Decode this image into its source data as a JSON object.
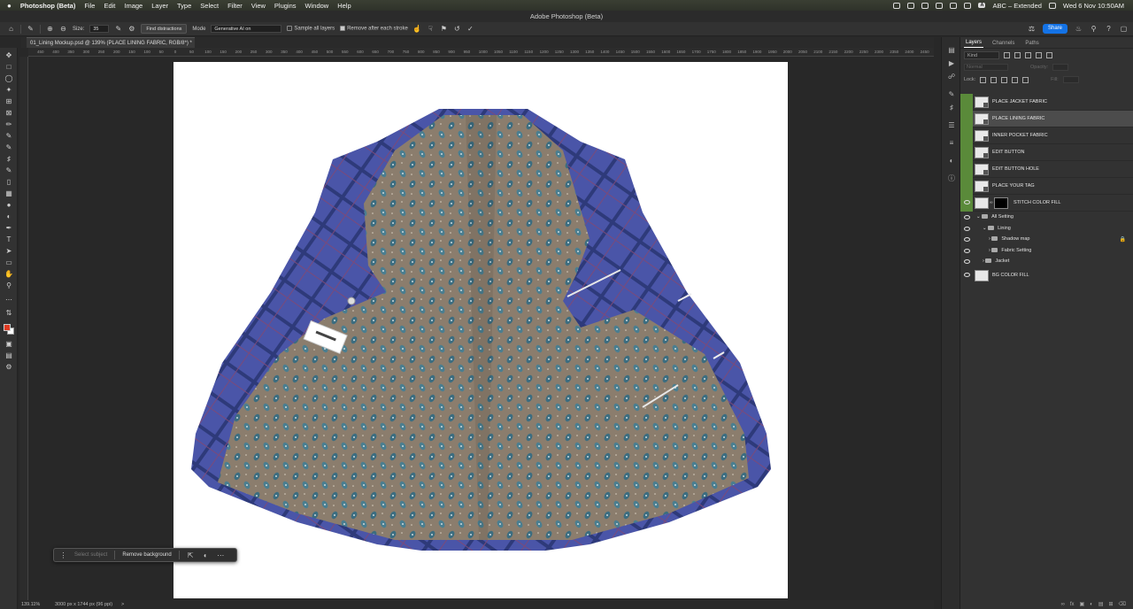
{
  "menubar": {
    "apple": "",
    "app_name": "Photoshop (Beta)",
    "items": [
      "File",
      "Edit",
      "Image",
      "Layer",
      "Type",
      "Select",
      "Filter",
      "View",
      "Plugins",
      "Window",
      "Help"
    ],
    "input_source": "ABC – Extended",
    "datetime": "Wed 6 Nov  10:50AM"
  },
  "window": {
    "title": "Adobe Photoshop (Beta)"
  },
  "options": {
    "size_label": "Size:",
    "size_value": "35",
    "find_distractions": "Find distractions",
    "mode_label": "Mode",
    "mode_value": "Generative AI on",
    "sample_all_layers": "Sample all layers",
    "remove_after_stroke": "Remove after each stroke",
    "share": "Share"
  },
  "document": {
    "tab": "01_Lining Mockup.psd @ 139% (PLACE LINING FABRIC, RGB/8*) *"
  },
  "ruler_ticks": [
    "450",
    "400",
    "350",
    "300",
    "250",
    "200",
    "150",
    "100",
    "50",
    "0",
    "50",
    "100",
    "150",
    "200",
    "250",
    "300",
    "350",
    "400",
    "450",
    "500",
    "550",
    "600",
    "650",
    "700",
    "750",
    "800",
    "850",
    "900",
    "950",
    "1000",
    "1050",
    "1100",
    "1150",
    "1200",
    "1250",
    "1300",
    "1350",
    "1400",
    "1450",
    "1500",
    "1550",
    "1600",
    "1650",
    "1700",
    "1750",
    "1800",
    "1850",
    "1900",
    "1950",
    "2000",
    "2050",
    "2100",
    "2150",
    "2200",
    "2250",
    "2300",
    "2350",
    "2400",
    "2450"
  ],
  "context_bar": {
    "select_subject": "Select subject",
    "remove_background": "Remove background"
  },
  "status": {
    "zoom": "139.11%",
    "dimensions": "3000 px x 1744 px (96 ppi)",
    "arrow": ">"
  },
  "panel": {
    "tabs": [
      "Layers",
      "Channels",
      "Paths"
    ],
    "kind": "Kind",
    "blend_mode": "Normal",
    "opacity_label": "Opacity:",
    "opacity_value": "",
    "lock_label": "Lock:",
    "fill_label": "Fill:",
    "fill_value": ""
  },
  "layers": [
    {
      "name": "PLACE JACKET FABRIC"
    },
    {
      "name": "PLACE LINING FABRIC"
    },
    {
      "name": "INNER POCKET FABRIC"
    },
    {
      "name": "EDIT BUTTON"
    },
    {
      "name": "EDIT BUTTON HOLE"
    },
    {
      "name": "PLACE YOUR TAG"
    },
    {
      "name": "STITCH COLOR FILL"
    }
  ],
  "groups": [
    {
      "name": "All Setting"
    },
    {
      "name": "Lining"
    },
    {
      "name": "Shadow map"
    },
    {
      "name": "Fabric Setting"
    },
    {
      "name": "Jacket"
    }
  ],
  "bg_layer": {
    "name": "BG COLOR FILL"
  },
  "colors": {
    "accent": "#1473e6",
    "layer_highlight": "#5a8a3a",
    "jacket_blue": "#4a55a8",
    "lining_brown": "#8a7a6a",
    "foreground": "#e03a22"
  }
}
